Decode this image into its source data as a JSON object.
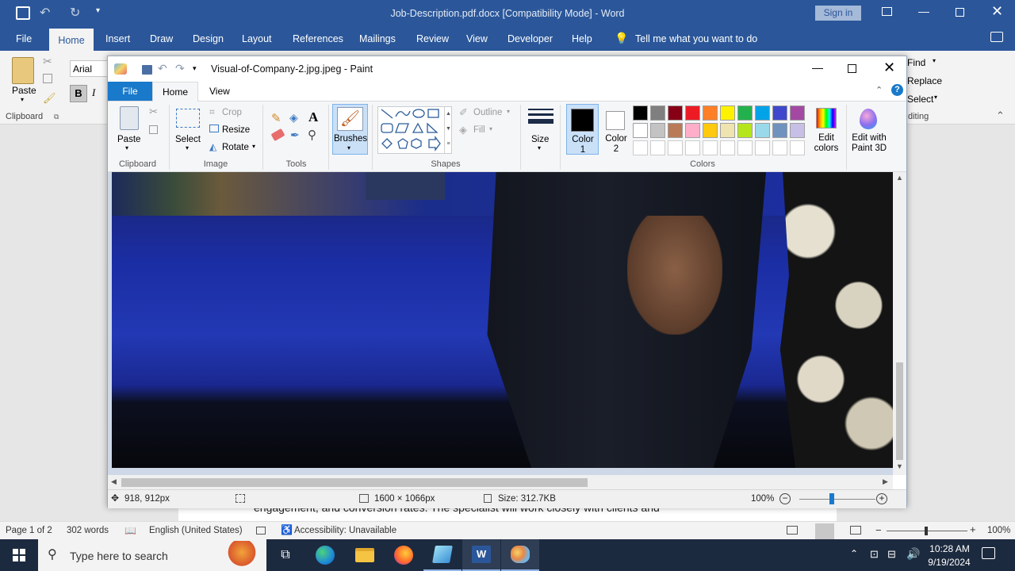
{
  "word": {
    "title": "Job-Description.pdf.docx [Compatibility Mode] - Word",
    "sign_in": "Sign in",
    "tabs": [
      "File",
      "Home",
      "Insert",
      "Draw",
      "Design",
      "Layout",
      "References",
      "Mailings",
      "Review",
      "View",
      "Developer",
      "Help"
    ],
    "tell_me": "Tell me what you want to do",
    "font_name": "Arial",
    "paste": "Paste",
    "clipboard": "Clipboard",
    "find": "Find",
    "replace": "Replace",
    "select": "Select",
    "editing": "diting",
    "doc_text": "engagement, and conversion rates. The specialist will work closely with clients and",
    "status": {
      "page": "Page 1 of 2",
      "words": "302 words",
      "language": "English (United States)",
      "accessibility": "Accessibility: Unavailable",
      "zoom": "100%"
    }
  },
  "paint": {
    "title": "Visual-of-Company-2.jpg.jpeg - Paint",
    "tabs": [
      "File",
      "Home",
      "View"
    ],
    "clipboard": {
      "paste": "Paste",
      "label": "Clipboard"
    },
    "image": {
      "select": "Select",
      "crop": "Crop",
      "resize": "Resize",
      "rotate": "Rotate",
      "label": "Image"
    },
    "tools_label": "Tools",
    "brushes": "Brushes",
    "shapes": {
      "outline": "Outline",
      "fill": "Fill",
      "label": "Shapes"
    },
    "size": "Size",
    "color1": "Color 1",
    "color2": "Color 2",
    "colors_label": "Colors",
    "edit_colors": "Edit colors",
    "edit_paint3d": "Edit with Paint 3D",
    "palette_row1": [
      "#000000",
      "#7f7f7f",
      "#880015",
      "#ed1c24",
      "#ff7f27",
      "#fff200",
      "#22b14c",
      "#00a2e8",
      "#3f48cc",
      "#a349a4"
    ],
    "palette_row2": [
      "#ffffff",
      "#c3c3c3",
      "#b97a57",
      "#ffaec9",
      "#ffc90e",
      "#efe4b0",
      "#b5e61d",
      "#99d9ea",
      "#7092be",
      "#c8bfe7"
    ],
    "status": {
      "cursor": "918, 912px",
      "dimensions": "1600 × 1066px",
      "size": "Size: 312.7KB",
      "zoom": "100%"
    }
  },
  "taskbar": {
    "search_placeholder": "Type here to search",
    "time": "10:28 AM",
    "date": "9/19/2024"
  }
}
